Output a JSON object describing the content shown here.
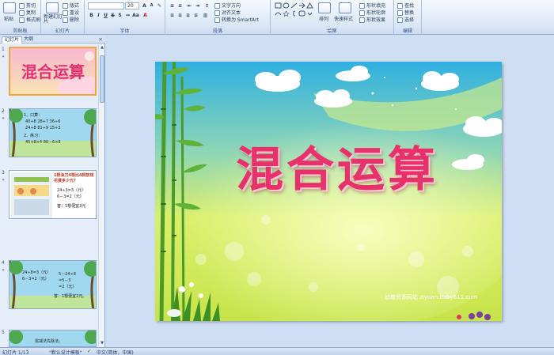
{
  "ribbon": {
    "groups": [
      {
        "label": "剪贴板",
        "buttons": [
          "粘贴",
          "剪切",
          "复制",
          "格式刷"
        ]
      },
      {
        "label": "幻灯片",
        "buttons": [
          "新建幻灯片",
          "版式",
          "重设",
          "删除"
        ]
      },
      {
        "label": "字体",
        "font_name": "",
        "font_size": "20"
      },
      {
        "label": "段落",
        "buttons": [
          "文字方向",
          "对齐文本",
          "转换为 SmartArt"
        ]
      },
      {
        "label": "绘图",
        "buttons": [
          "排列",
          "快速样式",
          "形状填充",
          "形状轮廓",
          "形状效果"
        ]
      },
      {
        "label": "编辑",
        "buttons": [
          "查找",
          "替换",
          "选择"
        ]
      }
    ]
  },
  "panel": {
    "tabs": [
      "幻灯片",
      "大纲"
    ],
    "close_glyph": "×",
    "thumbnails": [
      {
        "number": "1",
        "title": "混合运算"
      },
      {
        "number": "2",
        "lines": [
          "1、口算：",
          "40+8   28+7   36÷6",
          "24÷8   81÷9   15+3",
          "2、练习：",
          "45+8×4        80－6×8"
        ]
      },
      {
        "number": "3",
        "lines": [
          "1根油刀4根比4根放钱",
          "花费多少元？",
          "24÷3=3（元）",
          "6－3=2（元）",
          "答：1根便宜3元"
        ]
      },
      {
        "number": "4",
        "lines": [
          "24÷8=3（元）",
          "6－3=2（元）",
          "5－24÷8",
          "=5－3",
          "=2（元）",
          "答：1根便宜2元。"
        ]
      },
      {
        "number": "5",
        "lines": [
          "需减法先除法。"
        ]
      }
    ]
  },
  "slide": {
    "title": "混合运算",
    "watermark": "幼教资源网站  ziyuan.baby611.com",
    "colors": {
      "title": "#e8316a",
      "sky_top": "#2fb0e0",
      "sky_bottom": "#d9ef6a",
      "bamboo": "#4c9a2a"
    }
  },
  "status": {
    "slide_counter": "幻灯片 1/13",
    "theme": "\"默认设计模板\"",
    "language": "中文(简体，中国)"
  }
}
